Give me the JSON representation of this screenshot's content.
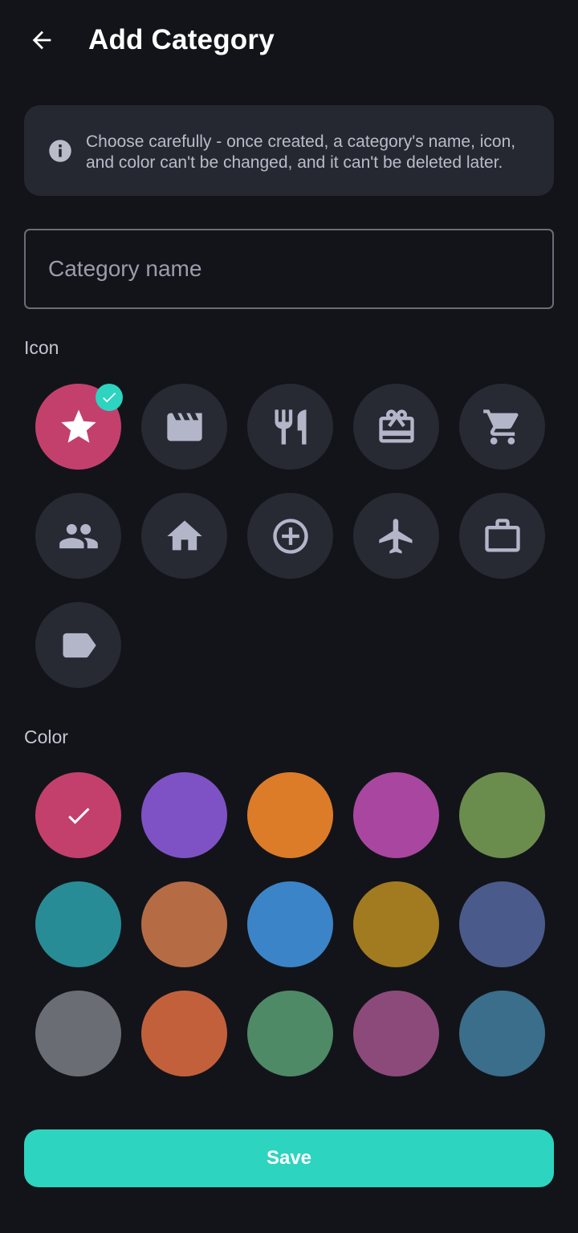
{
  "header": {
    "title": "Add Category",
    "back_icon": "arrow-left-icon"
  },
  "info": {
    "icon": "info-icon",
    "text": "Choose carefully - once created, a category's name, icon, and color can't be changed, and it can't be deleted later."
  },
  "name_field": {
    "placeholder": "Category name",
    "value": ""
  },
  "icon_section": {
    "label": "Icon",
    "selected_index": 0,
    "icons": [
      "star-icon",
      "movie-clapper-icon",
      "restaurant-icon",
      "gift-card-icon",
      "shopping-cart-icon",
      "people-icon",
      "home-icon",
      "medical-plus-icon",
      "airplane-icon",
      "briefcase-icon",
      "label-tag-icon"
    ]
  },
  "color_section": {
    "label": "Color",
    "selected_index": 0,
    "colors": [
      "#c3406d",
      "#7e52c4",
      "#dc7c29",
      "#a947a0",
      "#6a8d4d",
      "#288c96",
      "#b56c45",
      "#3c84c8",
      "#a27b20",
      "#4a5a8a",
      "#6a6e74",
      "#c3603c",
      "#4f8a67",
      "#8c4a7a",
      "#3a6e8a"
    ]
  },
  "theme": {
    "accent": "#2dd4bf",
    "background": "#131419",
    "surface": "#262831"
  },
  "save_button": {
    "label": "Save"
  }
}
